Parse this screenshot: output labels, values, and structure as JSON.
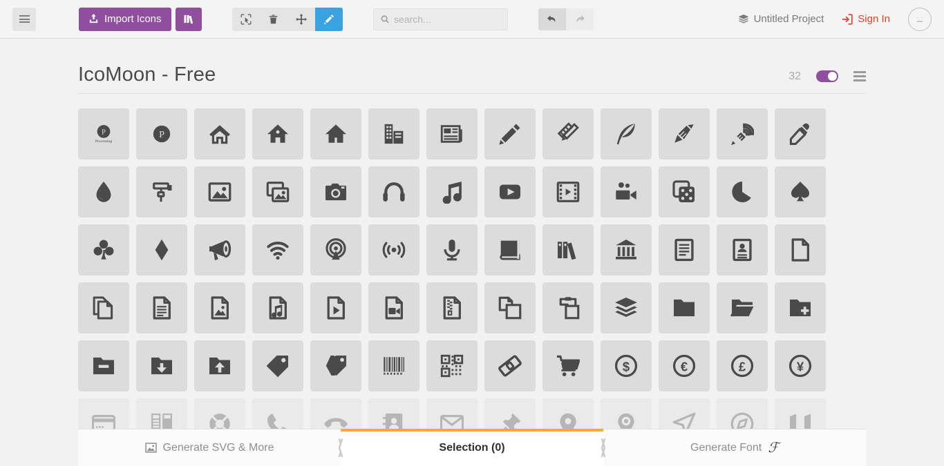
{
  "toolbar": {
    "menu_icon": "hamburger-menu-icon",
    "import_label": "Import Icons",
    "import_icon": "upload-icon",
    "library_icon": "books-icon",
    "tools": [
      {
        "name": "select-tool",
        "icon": "cursor-select-icon",
        "active": false
      },
      {
        "name": "delete-tool",
        "icon": "trash-icon",
        "active": false
      },
      {
        "name": "move-tool",
        "icon": "move-arrows-icon",
        "active": false
      },
      {
        "name": "edit-tool",
        "icon": "pencil-icon",
        "active": true
      }
    ],
    "search_placeholder": "search...",
    "search_value": "",
    "search_icon": "search-icon",
    "undo_icon": "undo-arrow-icon",
    "redo_icon": "redo-arrow-icon",
    "project_label": "Untitled Project",
    "project_icon": "stack-icon",
    "signin_label": "Sign In",
    "signin_icon": "login-icon",
    "avatar_icon": "neutral-face-icon",
    "accent_purple": "#8f4e9e",
    "accent_blue": "#38a3e0",
    "accent_red": "#e5402a"
  },
  "set": {
    "title": "IcoMoon - Free",
    "count": "32",
    "toggle_on": true,
    "menu_icon": "hamburger-menu-icon"
  },
  "icons": [
    {
      "name": "processing-logo-text-icon"
    },
    {
      "name": "processing-logo-icon"
    },
    {
      "name": "home-icon"
    },
    {
      "name": "home2-icon"
    },
    {
      "name": "home3-icon"
    },
    {
      "name": "office-icon"
    },
    {
      "name": "newspaper-icon"
    },
    {
      "name": "pencil-icon"
    },
    {
      "name": "pencil2-icon"
    },
    {
      "name": "quill-icon"
    },
    {
      "name": "pen-icon"
    },
    {
      "name": "blog-icon"
    },
    {
      "name": "eyedropper-icon"
    },
    {
      "name": "droplet-icon"
    },
    {
      "name": "paint-format-icon"
    },
    {
      "name": "image-icon"
    },
    {
      "name": "images-icon"
    },
    {
      "name": "camera-icon"
    },
    {
      "name": "headphones-icon"
    },
    {
      "name": "music-icon"
    },
    {
      "name": "play-icon"
    },
    {
      "name": "film-icon"
    },
    {
      "name": "video-camera-icon"
    },
    {
      "name": "dice-icon"
    },
    {
      "name": "pacman-icon"
    },
    {
      "name": "spades-icon"
    },
    {
      "name": "clubs-icon"
    },
    {
      "name": "diamonds-icon"
    },
    {
      "name": "bullhorn-icon"
    },
    {
      "name": "connection-icon"
    },
    {
      "name": "podcast-icon"
    },
    {
      "name": "feed-icon"
    },
    {
      "name": "mic-icon"
    },
    {
      "name": "book-icon"
    },
    {
      "name": "books-icon"
    },
    {
      "name": "library-icon"
    },
    {
      "name": "file-text-icon"
    },
    {
      "name": "profile-icon"
    },
    {
      "name": "file-empty-icon"
    },
    {
      "name": "files-empty-icon"
    },
    {
      "name": "file-text2-icon"
    },
    {
      "name": "file-picture-icon"
    },
    {
      "name": "file-music-icon"
    },
    {
      "name": "file-play-icon"
    },
    {
      "name": "file-video-icon"
    },
    {
      "name": "file-zip-icon"
    },
    {
      "name": "copy-icon"
    },
    {
      "name": "paste-icon"
    },
    {
      "name": "stack-icon"
    },
    {
      "name": "folder-icon"
    },
    {
      "name": "folder-open-icon"
    },
    {
      "name": "folder-plus-icon"
    },
    {
      "name": "folder-minus-icon"
    },
    {
      "name": "folder-download-icon"
    },
    {
      "name": "folder-upload-icon"
    },
    {
      "name": "price-tag-icon"
    },
    {
      "name": "price-tags-icon"
    },
    {
      "name": "barcode-icon"
    },
    {
      "name": "qrcode-icon"
    },
    {
      "name": "ticket-icon"
    },
    {
      "name": "cart-icon"
    },
    {
      "name": "coin-dollar-icon"
    },
    {
      "name": "coin-euro-icon"
    },
    {
      "name": "coin-pound-icon"
    },
    {
      "name": "coin-yen-icon"
    },
    {
      "name": "credit-card-icon"
    },
    {
      "name": "calculator-icon"
    },
    {
      "name": "lifebuoy-icon"
    },
    {
      "name": "phone-icon"
    },
    {
      "name": "phone-hang-up-icon"
    },
    {
      "name": "address-book-icon"
    },
    {
      "name": "envelop-icon"
    },
    {
      "name": "pushpin-icon"
    },
    {
      "name": "location-icon"
    },
    {
      "name": "location2-icon"
    },
    {
      "name": "compass-icon"
    },
    {
      "name": "compass2-icon"
    },
    {
      "name": "map-icon"
    }
  ],
  "footer": {
    "generate_svg_label": "Generate SVG & More",
    "generate_svg_icon": "image-icon",
    "selection_label": "Selection (0)",
    "generate_font_label": "Generate Font",
    "generate_font_icon": "font-f-icon",
    "accent_orange": "#f5a93d"
  }
}
